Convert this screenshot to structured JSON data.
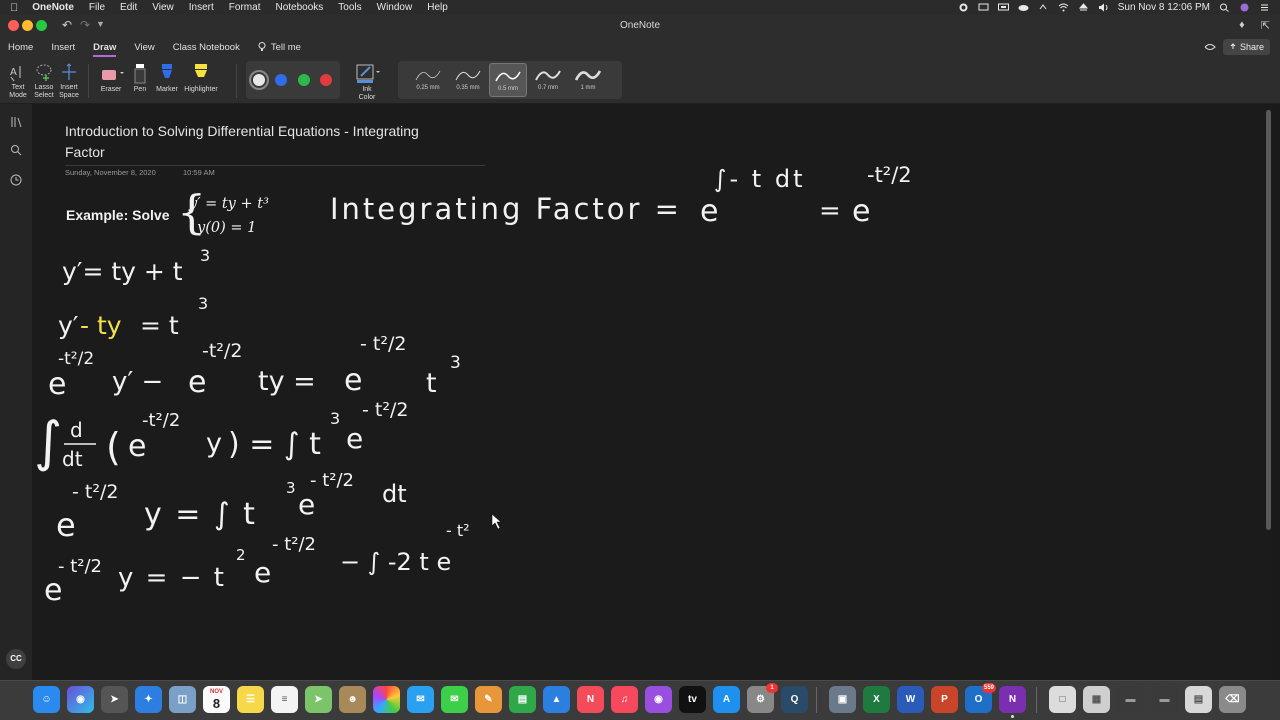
{
  "menubar": {
    "app_name": "OneNote",
    "items": [
      "File",
      "Edit",
      "View",
      "Insert",
      "Format",
      "Notebooks",
      "Tools",
      "Window",
      "Help"
    ],
    "clock": "Sun Nov 8  12:06 PM"
  },
  "window": {
    "title": "OneNote"
  },
  "ribbon_tabs": {
    "home": "Home",
    "insert": "Insert",
    "draw": "Draw",
    "view": "View",
    "class_notebook": "Class Notebook",
    "tell_me": "Tell me",
    "share": "Share"
  },
  "ribbon": {
    "text_mode": [
      "Text",
      "Mode"
    ],
    "lasso_select": [
      "Lasso",
      "Select"
    ],
    "insert_space": [
      "Insert",
      "Space"
    ],
    "eraser": "Eraser",
    "pen": "Pen",
    "marker": "Marker",
    "highlighter": "Highlighter",
    "ink_color": [
      "Ink",
      "Color"
    ],
    "colors": [
      "#e8e8e8",
      "#2f6ee8",
      "#2fb84a",
      "#e33b3b"
    ],
    "selected_color": "#e8e8e8",
    "thickness": [
      {
        "label": "0.25 mm",
        "width": 0.25
      },
      {
        "label": "0.35 mm",
        "width": 0.35
      },
      {
        "label": "0.5 mm",
        "width": 0.5
      },
      {
        "label": "0.7 mm",
        "width": 0.7
      },
      {
        "label": "1 mm",
        "width": 1
      }
    ],
    "selected_thickness": "0.5 mm"
  },
  "page": {
    "title_line1": "Introduction to Solving Differential Equations - Integrating",
    "title_line2": "Factor",
    "date": "Sunday, November 8, 2020",
    "time": "10:59 AM",
    "example_label": "Example: Solve",
    "system_eq1": "y′ = ty + t³",
    "system_eq2": "y(0) = 1"
  },
  "handwriting": {
    "ink_color": "#f2f2f2",
    "highlight_color": "#f4e24a",
    "integrating_factor_line": {
      "lhs": "Integrating Factor =",
      "e1": "e",
      "exp1": "∫- t dt",
      "eq": "=",
      "e2": "e",
      "exp2": "-t²/2"
    },
    "line1": {
      "lhs": "y′= ty + t",
      "exp": "3"
    },
    "line2": {
      "part1": "y′",
      "highlight": "- ty",
      "part2": "= t",
      "exp": "3"
    },
    "line3": {
      "e1": "e",
      "exp1": "-t²/2",
      "y": "y′ −",
      "e2": "e",
      "exp2": "-t²/2",
      "ty": "ty =",
      "e3": "e",
      "exp3": "- t²/2",
      "t": "t",
      "texp": "3"
    },
    "line4": {
      "integral": "∫",
      "frac_num": "d",
      "frac_den": "dt",
      "open": "(",
      "e1": "e",
      "exp1": "-t²/2",
      "y": "y",
      "close": ") = ∫ t",
      "texp": "3",
      "e2": "e",
      "exp2": "- t²/2"
    },
    "line5": {
      "e1": "e",
      "exp1": "- t²/2",
      "y": "y = ∫ t",
      "texp": "3",
      "e2": "e",
      "exp2": "- t²/2",
      "dt": "dt"
    },
    "line6": {
      "e1": "e",
      "exp1": "- t²/2",
      "y": "y = − t",
      "texp": "2",
      "e2": "e",
      "exp2": "- t²/2",
      "rest": "− ∫ -2 t e",
      "exp3": "- t²"
    }
  },
  "left_rail": {
    "cc": "CC"
  },
  "dock": {
    "calendar_month": "NOV",
    "calendar_day": "8",
    "app_store_badge": "1",
    "outlook_badge": "559"
  }
}
